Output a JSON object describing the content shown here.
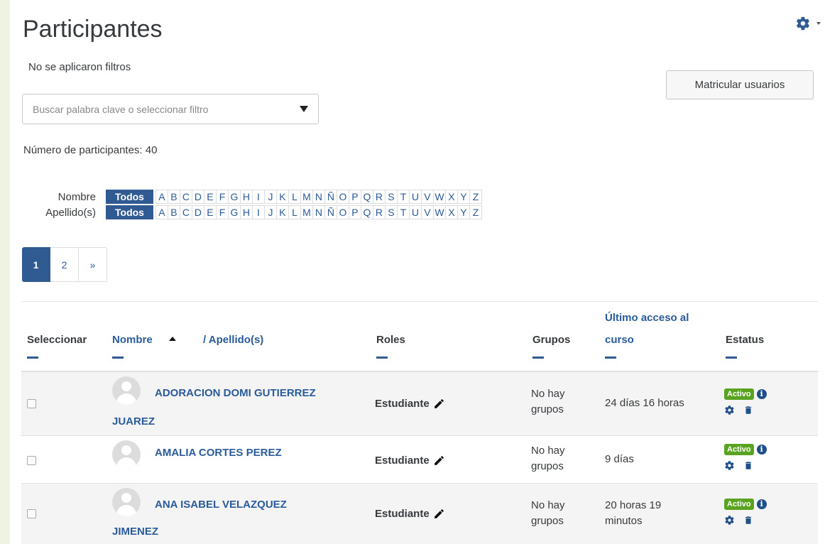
{
  "page": {
    "title": "Participantes",
    "filter_status": "No se aplicaron filtros",
    "enrol_button": "Matricular usuarios",
    "search_placeholder": "Buscar palabra clave o seleccionar filtro",
    "participant_count": "Número de participantes: 40"
  },
  "initials_bars": [
    {
      "label": "Nombre",
      "all": "Todos"
    },
    {
      "label": "Apellido(s)",
      "all": "Todos"
    }
  ],
  "letters": [
    "A",
    "B",
    "C",
    "D",
    "E",
    "F",
    "G",
    "H",
    "I",
    "J",
    "K",
    "L",
    "M",
    "N",
    "Ñ",
    "O",
    "P",
    "Q",
    "R",
    "S",
    "T",
    "U",
    "V",
    "W",
    "X",
    "Y",
    "Z"
  ],
  "pagination": {
    "pages": [
      "1",
      "2"
    ],
    "next": "»",
    "current": "1"
  },
  "table": {
    "headers": {
      "select": "Seleccionar",
      "name": "Nombre",
      "surname": "/ Apellido(s)",
      "roles": "Roles",
      "groups": "Grupos",
      "last_access_1": "Último acceso al",
      "last_access_2": "curso",
      "status": "Estatus"
    },
    "rows": [
      {
        "name_line1": "ADORACION DOMI GUTIERREZ",
        "name_line2": "JUAREZ",
        "role": "Estudiante",
        "groups_1": "No hay",
        "groups_2": "grupos",
        "access_1": "24 días 16 horas",
        "access_2": "",
        "status": "Activo"
      },
      {
        "name_line1": "AMALIA CORTES PEREZ",
        "name_line2": "",
        "role": "Estudiante",
        "groups_1": "No hay",
        "groups_2": "grupos",
        "access_1": "9 días",
        "access_2": "",
        "status": "Activo"
      },
      {
        "name_line1": "ANA ISABEL VELAZQUEZ",
        "name_line2": "JIMENEZ",
        "role": "Estudiante",
        "groups_1": "No hay",
        "groups_2": "grupos",
        "access_1": "20 horas 19",
        "access_2": "minutos",
        "status": "Activo"
      }
    ]
  },
  "colors": {
    "primary": "#2f5a92",
    "link": "#2a5b9a",
    "active_badge": "#5aa321"
  },
  "icons": {
    "settings": "gear-icon",
    "edit": "pencil-icon",
    "info": "info-icon",
    "delete": "trash-icon",
    "sort": "sort-asc-icon"
  }
}
